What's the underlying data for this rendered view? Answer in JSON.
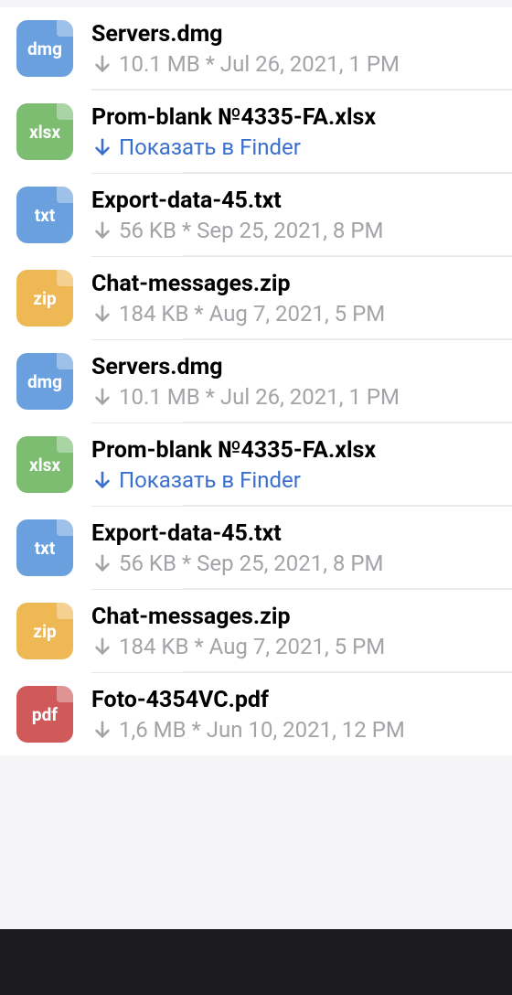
{
  "files": [
    {
      "name": "Servers.dmg",
      "ext": "dmg",
      "icon_class": "icon-dmg",
      "meta_type": "info",
      "meta_text": "10.1 MB * Jul 26, 2021, 1 PM",
      "arrow_color": "#a3a3a8"
    },
    {
      "name": "Prom-blank №4335-FA.xlsx",
      "ext": "xlsx",
      "icon_class": "icon-xlsx",
      "meta_type": "link",
      "meta_text": "Показать в Finder",
      "arrow_color": "#3a6fcf"
    },
    {
      "name": "Export-data-45.txt",
      "ext": "txt",
      "icon_class": "icon-txt",
      "meta_type": "info",
      "meta_text": "56 KB * Sep 25, 2021, 8 PM",
      "arrow_color": "#a3a3a8"
    },
    {
      "name": "Chat-messages.zip",
      "ext": "zip",
      "icon_class": "icon-zip",
      "meta_type": "info",
      "meta_text": "184 KB * Aug 7, 2021, 5 PM",
      "arrow_color": "#a3a3a8"
    },
    {
      "name": "Servers.dmg",
      "ext": "dmg",
      "icon_class": "icon-dmg",
      "meta_type": "info",
      "meta_text": "10.1 MB * Jul 26, 2021, 1 PM",
      "arrow_color": "#a3a3a8"
    },
    {
      "name": "Prom-blank №4335-FA.xlsx",
      "ext": "xlsx",
      "icon_class": "icon-xlsx",
      "meta_type": "link",
      "meta_text": "Показать в Finder",
      "arrow_color": "#3a6fcf"
    },
    {
      "name": "Export-data-45.txt",
      "ext": "txt",
      "icon_class": "icon-txt",
      "meta_type": "info",
      "meta_text": "56 KB * Sep 25, 2021, 8 PM",
      "arrow_color": "#a3a3a8"
    },
    {
      "name": "Chat-messages.zip",
      "ext": "zip",
      "icon_class": "icon-zip",
      "meta_type": "info",
      "meta_text": "184 KB * Aug 7, 2021, 5 PM",
      "arrow_color": "#a3a3a8"
    },
    {
      "name": "Foto-4354VC.pdf",
      "ext": "pdf",
      "icon_class": "icon-pdf",
      "meta_type": "info",
      "meta_text": "1,6 MB * Jun 10, 2021, 12 PM",
      "arrow_color": "#a3a3a8"
    }
  ]
}
